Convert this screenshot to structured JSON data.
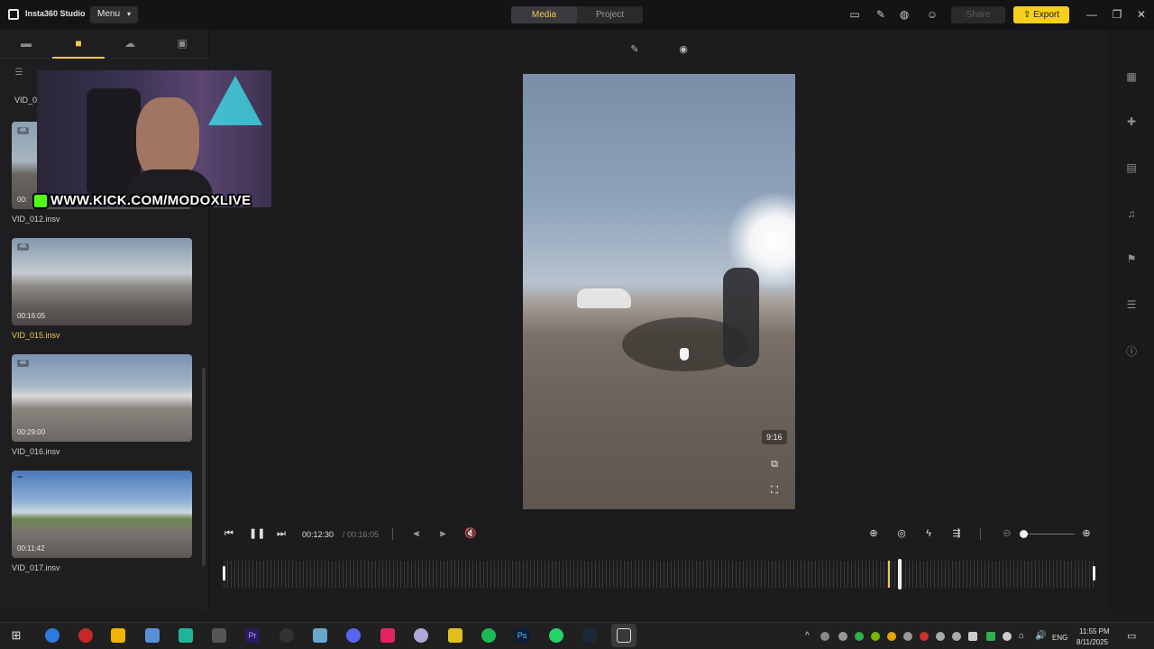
{
  "app": {
    "name": "Insta360 Studio",
    "menu_label": "Menu"
  },
  "header": {
    "tabs": [
      {
        "label": "Media",
        "active": true
      },
      {
        "label": "Project",
        "active": false
      }
    ],
    "share_label": "Share",
    "export_label": "Export",
    "accent": "#f5cf1c"
  },
  "sidebar": {
    "clips": [
      {
        "name": "VID_012.insv",
        "duration": "00:",
        "badge": "4K",
        "active": false
      },
      {
        "name": "VID_015.insv",
        "duration": "00:16:05",
        "badge": "4K",
        "active": true
      },
      {
        "name": "VID_016.insv",
        "duration": "00:29:00",
        "badge": "4K",
        "active": false
      },
      {
        "name": "VID_017.insv",
        "duration": "00:11:42",
        "badge": "",
        "active": false
      }
    ],
    "partial_top_clip": "VID_0"
  },
  "preview": {
    "ratio": "9:16"
  },
  "transport": {
    "current_time": "00:12:30",
    "total_time": "/ 00:16:05"
  },
  "overlay": {
    "webcam_text": "WWW.KICK.COM/MODOXLIVE"
  },
  "taskbar": {
    "lang": "ENG",
    "time": "11:55 PM",
    "date": "8/11/2025"
  }
}
